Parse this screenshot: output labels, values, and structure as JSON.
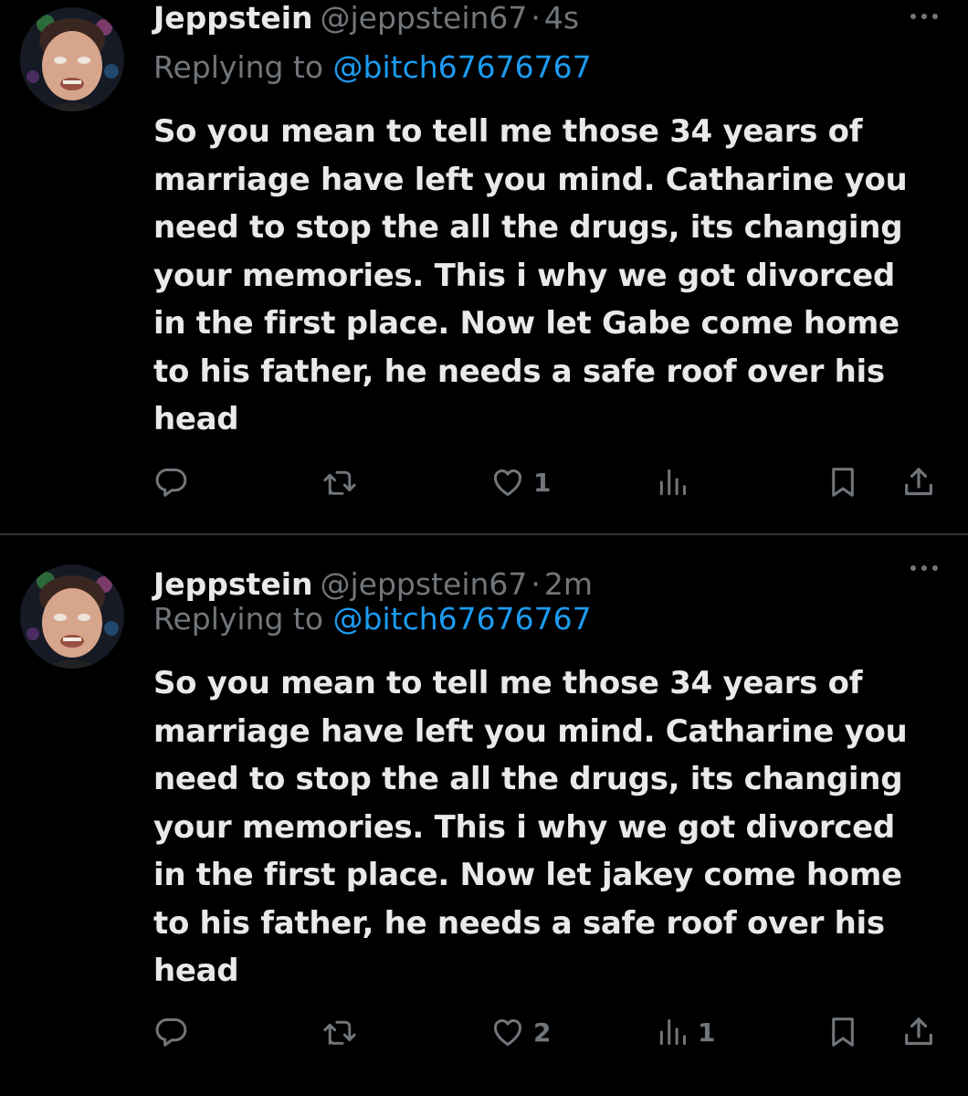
{
  "colors": {
    "background": "#000000",
    "primary_text": "#e7e9ea",
    "secondary_text": "#71767b",
    "accent": "#1d9bf0",
    "divider": "#2f3336"
  },
  "tweets": [
    {
      "display_name": "Jeppstein",
      "handle": "@jeppstein67",
      "separator": "·",
      "time": "4s",
      "replying_prefix": "Replying to",
      "replying_to": "@bitch67676767",
      "text_lines": [
        "So you mean to tell me those 34 years of",
        "marriage have left you mind. Catharine you",
        "need to stop the all the drugs, its changing",
        "your memories. This i why we got divorced",
        "in the first place. Now let Gabe come home",
        "to his father, he needs a safe roof over his",
        "head"
      ],
      "actions": {
        "reply_icon": "reply-icon",
        "retweet_icon": "retweet-icon",
        "like_icon": "heart-icon",
        "like_count": "1",
        "views_icon": "views-icon",
        "views_count": "",
        "bookmark_icon": "bookmark-icon",
        "share_icon": "share-icon"
      }
    },
    {
      "display_name": "Jeppstein",
      "handle": "@jeppstein67",
      "separator": "·",
      "time": "2m",
      "replying_prefix": "Replying to",
      "replying_to": "@bitch67676767",
      "text_lines": [
        "So you mean to tell me those 34 years of",
        "marriage have left you mind. Catharine you",
        "need to stop the all the drugs, its changing",
        "your memories. This i why we got divorced",
        "in the first place. Now let jakey come home",
        "to his father, he needs a safe roof over his",
        "head"
      ],
      "actions": {
        "reply_icon": "reply-icon",
        "retweet_icon": "retweet-icon",
        "like_icon": "heart-icon",
        "like_count": "2",
        "views_icon": "views-icon",
        "views_count": "1",
        "bookmark_icon": "bookmark-icon",
        "share_icon": "share-icon"
      }
    }
  ]
}
